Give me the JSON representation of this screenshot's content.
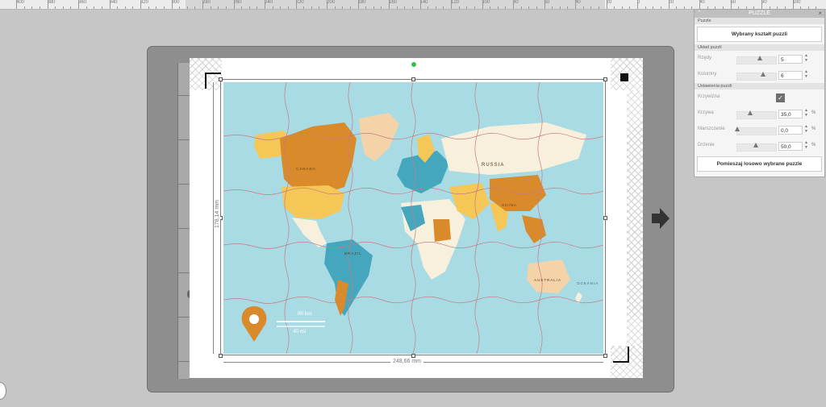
{
  "ruler": {
    "labels": [
      "400",
      "380",
      "360",
      "340",
      "320",
      "300",
      "280",
      "260",
      "240",
      "220",
      "200",
      "180",
      "160",
      "140",
      "120",
      "100",
      "80",
      "60",
      "40",
      "20",
      "0",
      "20",
      "40",
      "60",
      "80",
      "100"
    ]
  },
  "canvas": {
    "width_label": "248,66 mm",
    "height_label": "178,14 mm"
  },
  "map": {
    "labels": {
      "russia": "RUSSIA",
      "canada": "CANADA",
      "china": "CHINA",
      "brazil": "BRAZIL",
      "australia": "AUSTRALIA",
      "oceania": "OCEANIA"
    },
    "scale": {
      "km": "80 km",
      "mi": "40 mi"
    }
  },
  "panel": {
    "title": "PUZZLE",
    "section_puzzle": "Puzzle",
    "choose_shape_button": "Wybrany kształt puzzli",
    "section_layout": "Układ puzzli",
    "rows": {
      "label": "Rzędy",
      "value": "5"
    },
    "columns": {
      "label": "Kolumny",
      "value": "6"
    },
    "section_settings": "Ustawienia puzzli",
    "curve_toggle": {
      "label": "Krzywizna",
      "checked": true
    },
    "curve": {
      "label": "Krzywa",
      "value": "35,0",
      "unit": "%",
      "level": 0.35
    },
    "wrinkle": {
      "label": "Marszczenie",
      "value": "0,0",
      "unit": "%",
      "level": 0.0
    },
    "tremble": {
      "label": "Drżenie",
      "value": "50,0",
      "unit": "%",
      "level": 0.5
    },
    "shuffle_button": "Pomieszaj losowo wybrane puzzle"
  },
  "colors": {
    "ocean": "#a9dbe5",
    "land_orange": "#d98a2b",
    "land_yellow": "#f4c756",
    "land_cream": "#f7f0dc",
    "land_teal": "#45a7bd",
    "land_peach": "#f5d3a8",
    "accent_green": "#35c14a"
  }
}
